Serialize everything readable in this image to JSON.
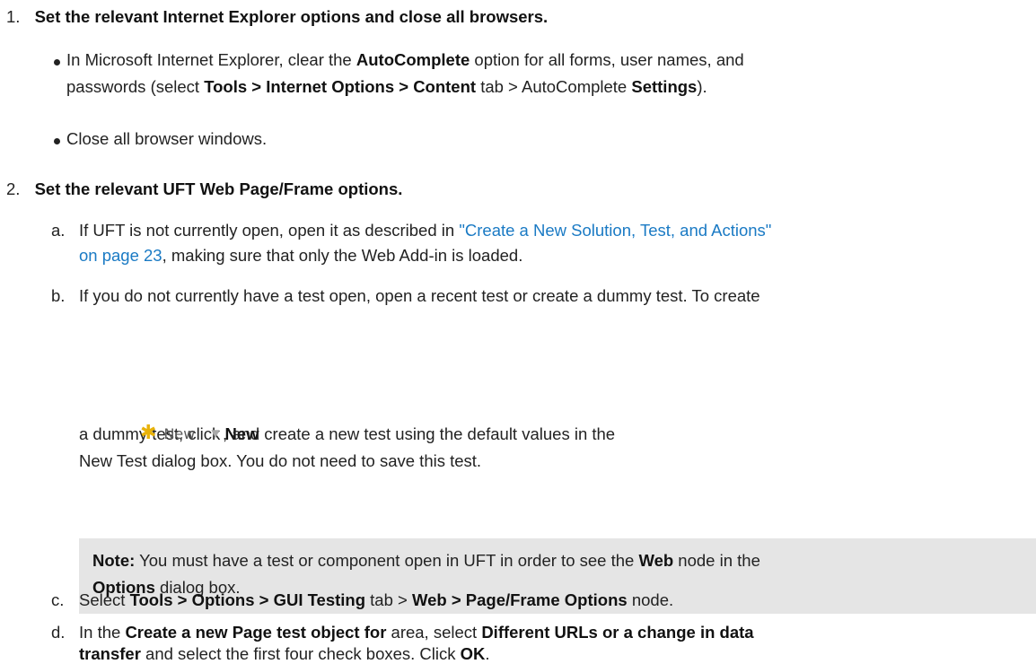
{
  "step1": {
    "number": "1.",
    "heading": "Set the relevant Internet Explorer options and close all browsers.",
    "bullet1": {
      "l1_a": "In Microsoft Internet Explorer, clear the ",
      "l1_b": "AutoComplete",
      "l1_c": " option for all forms, user names, and",
      "l2_a": "passwords (select ",
      "l2_b": "Tools > Internet Options > Content",
      "l2_c": " tab > AutoComplete ",
      "l2_d": "Settings",
      "l2_e": ")."
    },
    "bullet2": "Close all browser windows."
  },
  "step2": {
    "number": "2.",
    "heading": "Set the relevant UFT Web Page/Frame options.",
    "a": {
      "letter": "a.",
      "l1_a": "If UFT is not currently open, open it as described in ",
      "link_l1": "\"Create a New Solution, Test, and Actions\"",
      "link_l2": "on page 23",
      "l2_b": ", making sure that only the Web Add-in is loaded."
    },
    "b": {
      "letter": "b.",
      "l1": "If you do not currently have a test open, open a recent test or create a dummy test. To create",
      "l2_a": "a dummy test, click ",
      "l2_b": "New",
      "l2_c": ", and create a new test using the default values in the",
      "l3": "New Test dialog box. You do not need to save this test.",
      "new_button_label": "New"
    },
    "note": {
      "l1_a": "Note:",
      "l1_b": " You must have a test or component open in UFT in order to see the ",
      "l1_c": "Web",
      "l1_d": " node in the",
      "l2_a": "Options",
      "l2_b": " dialog box."
    },
    "c": {
      "letter": "c.",
      "t1": "Select ",
      "t2": "Tools > Options > GUI Testing",
      "t3": " tab > ",
      "t4": "Web > Page/Frame Options",
      "t5": " node."
    },
    "d": {
      "letter": "d.",
      "l1_a": "In the ",
      "l1_b": "Create a new Page test object for",
      "l1_c": " area, select ",
      "l1_d": "Different URLs or a change in data",
      "l2_a": "transfer",
      "l2_b": " and select the first four check boxes. Click ",
      "l2_c": "OK",
      "l2_d": "."
    }
  }
}
